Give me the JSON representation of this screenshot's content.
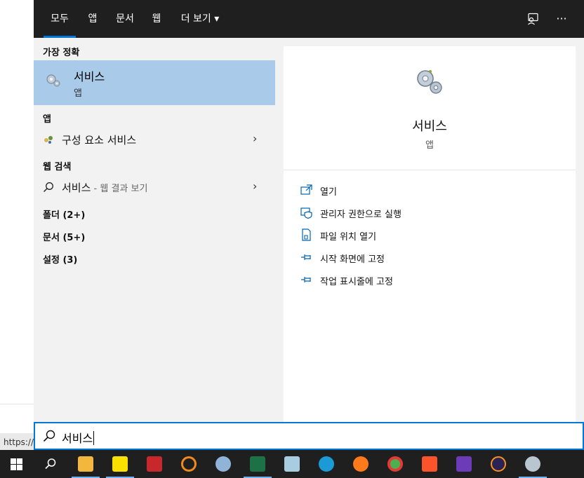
{
  "background": {
    "status_url": "https://t"
  },
  "tabs": [
    {
      "label": "모두",
      "active": true
    },
    {
      "label": "앱"
    },
    {
      "label": "문서"
    },
    {
      "label": "웹"
    },
    {
      "label": "더 보기 ▾"
    }
  ],
  "toolbar": {
    "feedback_icon": "feedback-icon",
    "more_label": "···"
  },
  "best_match": {
    "heading": "가장 정확",
    "title": "서비스",
    "subtitle": "앱"
  },
  "apps": {
    "heading": "앱",
    "items": [
      {
        "label": "구성 요소 서비스"
      }
    ]
  },
  "web": {
    "heading": "웹 검색",
    "query": "서비스",
    "suffix": " - 웹 결과 보기"
  },
  "categories": [
    {
      "label": "폴더 (2+)"
    },
    {
      "label": "문서 (5+)"
    },
    {
      "label": "설정 (3)"
    }
  ],
  "preview": {
    "title": "서비스",
    "subtitle": "앱",
    "actions": [
      {
        "label": "열기",
        "icon": "open-icon"
      },
      {
        "label": "관리자 권한으로 실행",
        "icon": "shield-icon"
      },
      {
        "label": "파일 위치 열기",
        "icon": "file-location-icon"
      },
      {
        "label": "시작 화면에 고정",
        "icon": "pin-icon"
      },
      {
        "label": "작업 표시줄에 고정",
        "icon": "pin-icon"
      }
    ]
  },
  "search": {
    "value": "서비스"
  },
  "taskbar": {
    "items": [
      {
        "name": "start-icon"
      },
      {
        "name": "search-icon"
      },
      {
        "name": "file-explorer-icon"
      },
      {
        "name": "kakaotalk-icon"
      },
      {
        "name": "app-red-icon"
      },
      {
        "name": "magnifier-app-icon"
      },
      {
        "name": "paint-icon"
      },
      {
        "name": "excel-icon"
      },
      {
        "name": "notepad-icon"
      },
      {
        "name": "edge-icon"
      },
      {
        "name": "firefox-icon"
      },
      {
        "name": "chrome-icon"
      },
      {
        "name": "brave-icon"
      },
      {
        "name": "visual-studio-icon"
      },
      {
        "name": "eclipse-icon"
      },
      {
        "name": "services-icon"
      }
    ]
  },
  "colors": {
    "accent": "#0078d7",
    "selection": "#a9cbe9",
    "topbar": "#1f1f1f"
  }
}
